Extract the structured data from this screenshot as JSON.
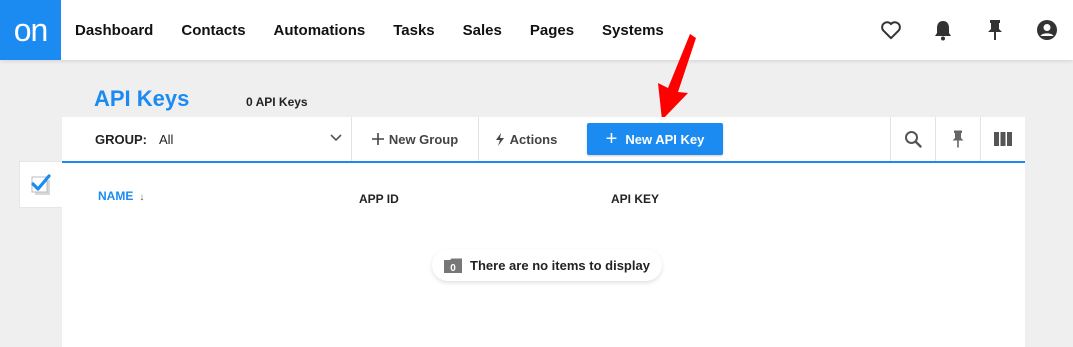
{
  "logo": "on",
  "nav": [
    "Dashboard",
    "Contacts",
    "Automations",
    "Tasks",
    "Sales",
    "Pages",
    "Systems"
  ],
  "top_icons": [
    "heart-icon",
    "bell-icon",
    "pin-icon",
    "user-icon"
  ],
  "page": {
    "title": "API Keys",
    "count": "0 API Keys"
  },
  "toolbar": {
    "group_label": "GROUP:",
    "group_value": "All",
    "new_group": "New Group",
    "actions": "Actions",
    "new_api_key": "New API Key",
    "right_icons": [
      "search-icon",
      "pin-icon",
      "columns-icon"
    ]
  },
  "table": {
    "columns": [
      "NAME",
      "APP ID",
      "API KEY"
    ],
    "sort_column": "NAME"
  },
  "empty_message": "There are no items to display",
  "colors": {
    "accent": "#1b8bf2",
    "annotation": "#ff0000"
  }
}
